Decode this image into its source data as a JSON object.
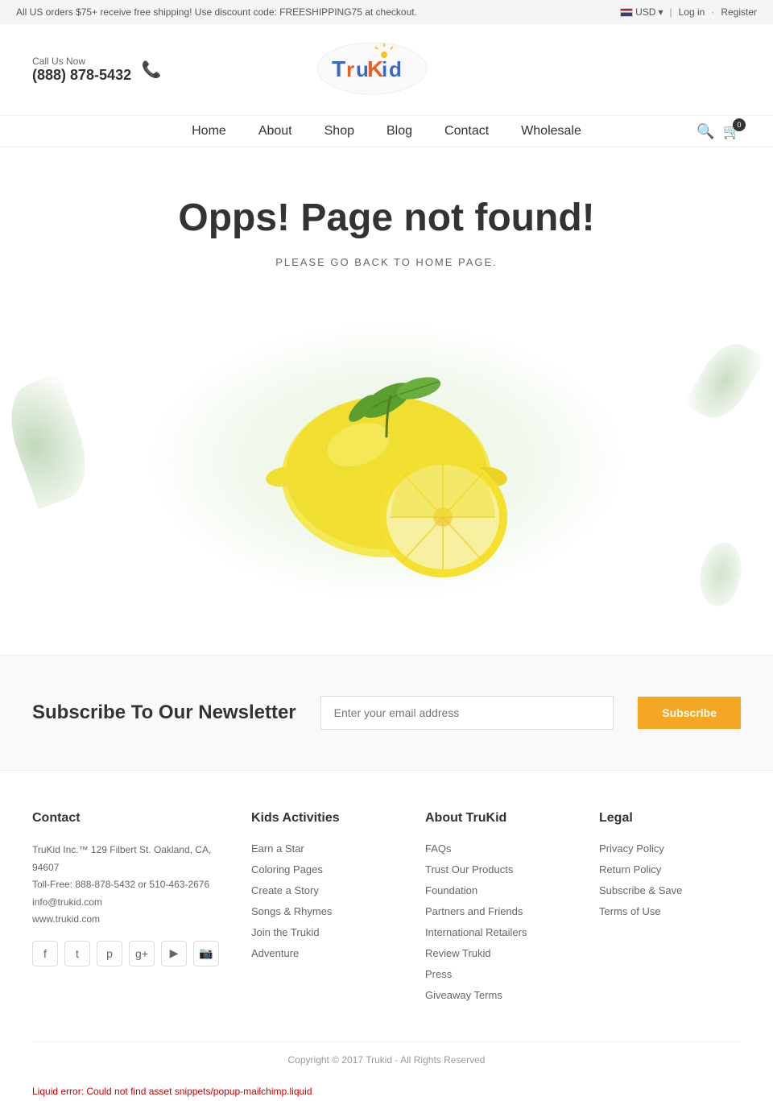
{
  "topbar": {
    "promo_text": "All US orders $75+ receive free shipping! Use discount code: FREESHIPPING75 at checkout.",
    "currency_label": "USD",
    "login_label": "Log in",
    "register_label": "Register"
  },
  "header": {
    "call_label": "Call Us Now",
    "phone": "(888) 878-5432",
    "cart_count": "0"
  },
  "nav": {
    "items": [
      {
        "label": "Home",
        "href": "#"
      },
      {
        "label": "About",
        "href": "#"
      },
      {
        "label": "Shop",
        "href": "#"
      },
      {
        "label": "Blog",
        "href": "#"
      },
      {
        "label": "Contact",
        "href": "#"
      },
      {
        "label": "Wholesale",
        "href": "#"
      }
    ]
  },
  "error_page": {
    "title": "Opps! Page not found!",
    "subtitle": "PLEASE GO BACK TO HOME PAGE."
  },
  "newsletter": {
    "title": "Subscribe To Our Newsletter",
    "input_placeholder": "Enter your email address",
    "button_label": "Subscribe"
  },
  "footer": {
    "contact": {
      "title": "Contact",
      "address": "TruKid Inc.™ 129 Filbert St. Oakland, CA, 94607",
      "toll_free": "Toll-Free: 888-878-5432 or 510-463-2676",
      "email": "info@trukid.com",
      "website": "www.trukid.com"
    },
    "kids_activities": {
      "title": "Kids Activities",
      "links": [
        "Earn a Star",
        "Coloring Pages",
        "Create a Story",
        "Songs & Rhymes",
        "Join the Trukid",
        "Adventure"
      ]
    },
    "about_trukid": {
      "title": "About TruKid",
      "links": [
        "FAQs",
        "Trust Our Products",
        "Foundation",
        "Partners and Friends",
        "International Retailers",
        "Review Trukid",
        "Press",
        "Giveaway Terms"
      ]
    },
    "legal": {
      "title": "Legal",
      "links": [
        "Privacy Policy",
        "Return Policy",
        "Subscribe & Save",
        "Terms of Use"
      ]
    },
    "copyright": "Copyright © 2017 Trukid - All Rights Reserved",
    "liquid_error": "Liquid error: Could not find asset snippets/popup-mailchimp.liquid"
  }
}
